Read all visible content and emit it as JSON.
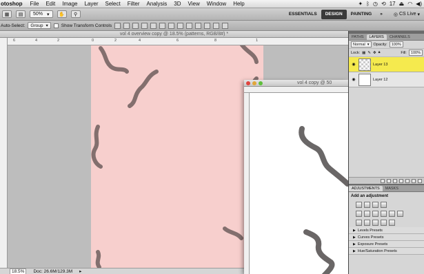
{
  "menubar": {
    "app_name": "otoshop",
    "items": [
      "File",
      "Edit",
      "Image",
      "Layer",
      "Select",
      "Filter",
      "Analysis",
      "3D",
      "View",
      "Window",
      "Help"
    ],
    "status": {
      "battery": "17"
    }
  },
  "appbar": {
    "zoom_value": "50%",
    "workspaces": [
      "ESSENTIALS",
      "DESIGN",
      "PAINTING"
    ],
    "active_workspace": "DESIGN",
    "more": "»",
    "cs_live": "CS Live"
  },
  "options_bar": {
    "auto_select_label": "Auto-Select:",
    "auto_select_value": "Group",
    "show_transform": "Show Transform Controls"
  },
  "doc1": {
    "title": "vol 4 overview copy @ 18.5% (patterns, RGB/8#) *",
    "ruler_ticks": [
      "6",
      "4",
      "2",
      "0",
      "2",
      "4",
      "6",
      "8",
      "1"
    ],
    "status_zoom": "18.5%",
    "status_doc": "Doc: 26.6M/129.3M",
    "canvas_color": "#f7cfcd"
  },
  "doc2": {
    "title": "vol 4 copy @ 50"
  },
  "layers_panel": {
    "tabs": [
      "PATHS",
      "LAYERS",
      "CHANNELS"
    ],
    "active_tab": "LAYERS",
    "blend_mode": "Normal",
    "opacity_label": "Opacity:",
    "opacity_value": "100%",
    "lock_label": "Lock:",
    "fill_label": "Fill:",
    "fill_value": "100%",
    "layers": [
      {
        "name": "Layer 13",
        "selected": true
      },
      {
        "name": "Layer 12",
        "selected": false
      }
    ],
    "highlight_color": "#f5ea4e"
  },
  "adjustments_panel": {
    "tabs": [
      "ADJUSTMENTS",
      "MASKS"
    ],
    "active_tab": "ADJUSTMENTS",
    "title": "Add an adjustment",
    "presets": [
      "Levels Presets",
      "Curves Presets",
      "Exposure Presets",
      "Hue/Saturation Presets"
    ]
  }
}
